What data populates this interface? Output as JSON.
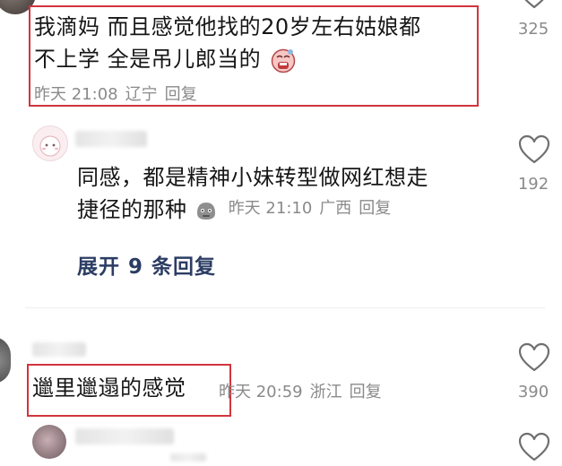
{
  "comment1": {
    "text_line1": "我滴妈 而且感觉他找的20岁左右姑娘都",
    "text_line2": "不上学 全是吊儿郎当的",
    "emoji": "crying-face-emoji",
    "time": "昨天 21:08",
    "location": "辽宁",
    "reply": "回复",
    "likes": "325"
  },
  "reply1": {
    "text_line1": "同感，都是精神小妹转型做网红想走",
    "text_line2": "捷径的那种",
    "emoji": "gray-face-emoji",
    "time": "昨天 21:10",
    "location": "广西",
    "reply": "回复",
    "likes": "192"
  },
  "expand_replies": "展开 9 条回复",
  "comment2": {
    "text": "邋里邋遢的感觉",
    "time": "昨天 20:59",
    "location": "浙江",
    "reply": "回复",
    "likes": "390"
  },
  "colors": {
    "highlight": "#d2343d",
    "expand_link": "#2c3d64",
    "meta": "#8a8a8a"
  }
}
